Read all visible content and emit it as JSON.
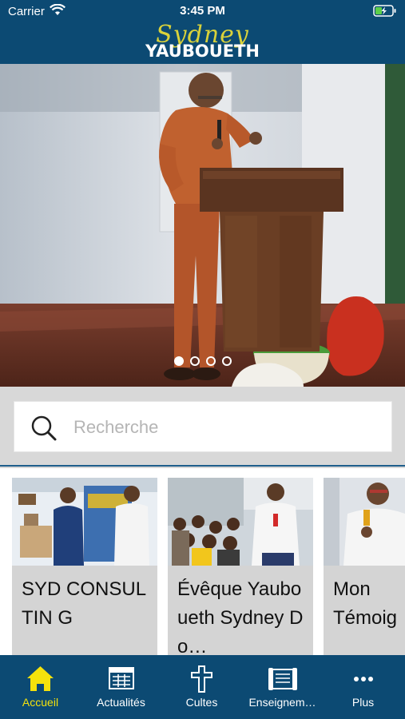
{
  "status_bar": {
    "carrier": "Carrier",
    "time": "3:45 PM"
  },
  "header": {
    "logo_script": "Sydney",
    "logo_name": "YAUBOUETH"
  },
  "carousel": {
    "slides_total": 4,
    "active_index": 0
  },
  "search": {
    "placeholder": "Recherche",
    "value": ""
  },
  "cards": [
    {
      "title": "SYD CONSULTIN G"
    },
    {
      "title": "Évêque Yauboueth Sydney Do…"
    },
    {
      "title": "Mon Témoig"
    }
  ],
  "tabbar": {
    "active": "Accueil",
    "tabs": [
      {
        "label": "Accueil",
        "icon": "home-icon"
      },
      {
        "label": "Actualités",
        "icon": "newspaper-icon"
      },
      {
        "label": "Cultes",
        "icon": "cross-icon"
      },
      {
        "label": "Enseignem…",
        "icon": "scroll-icon"
      },
      {
        "label": "Plus",
        "icon": "more-icon"
      }
    ]
  },
  "colors": {
    "brand": "#0c4a73",
    "active_tab": "#f4e20c",
    "logo_accent": "#d9d23a"
  }
}
